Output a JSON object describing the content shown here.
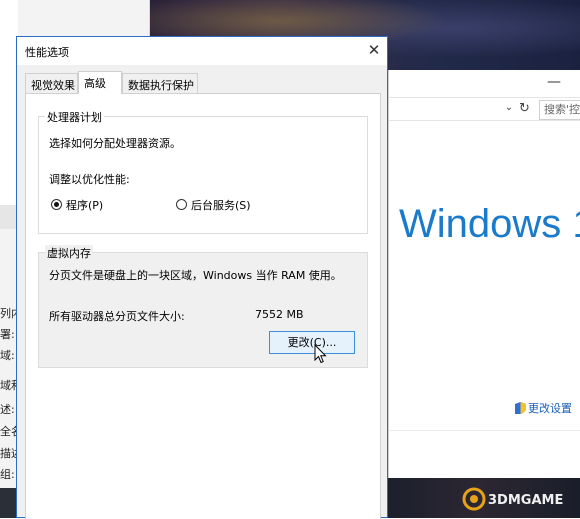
{
  "dialog": {
    "title": "性能选项",
    "close_label": "✕",
    "tabs": [
      "视觉效果",
      "高级",
      "数据执行保护"
    ],
    "active_tab": "高级",
    "processor": {
      "title": "处理器计划",
      "description": "选择如何分配处理器资源。",
      "optimize_label": "调整以优化性能:",
      "options": [
        {
          "label": "程序(P)",
          "checked": true
        },
        {
          "label": "后台服务(S)",
          "checked": false
        }
      ]
    },
    "virtual_memory": {
      "title": "虚拟内存",
      "description": "分页文件是硬盘上的一块区域，Windows 当作 RAM 使用。",
      "total_label": "所有驱动器总分页文件大小:",
      "total_value": "7552 MB",
      "change_button": "更改(C)..."
    }
  },
  "background_window": {
    "search_placeholder": "搜索'控",
    "windows_brand": "Windows 1",
    "change_settings_link": "更改设置",
    "left_fragments": [
      "列内",
      "署:",
      "域:",
      "域和",
      "述:",
      "全名",
      "描述",
      "组:"
    ]
  },
  "watermark": {
    "text": "3DMGAME"
  },
  "colors": {
    "accent": "#2b6cc4",
    "brand_blue": "#1a7acb",
    "button_border": "#3c8ed8",
    "button_fill": "#e5f1fb"
  }
}
